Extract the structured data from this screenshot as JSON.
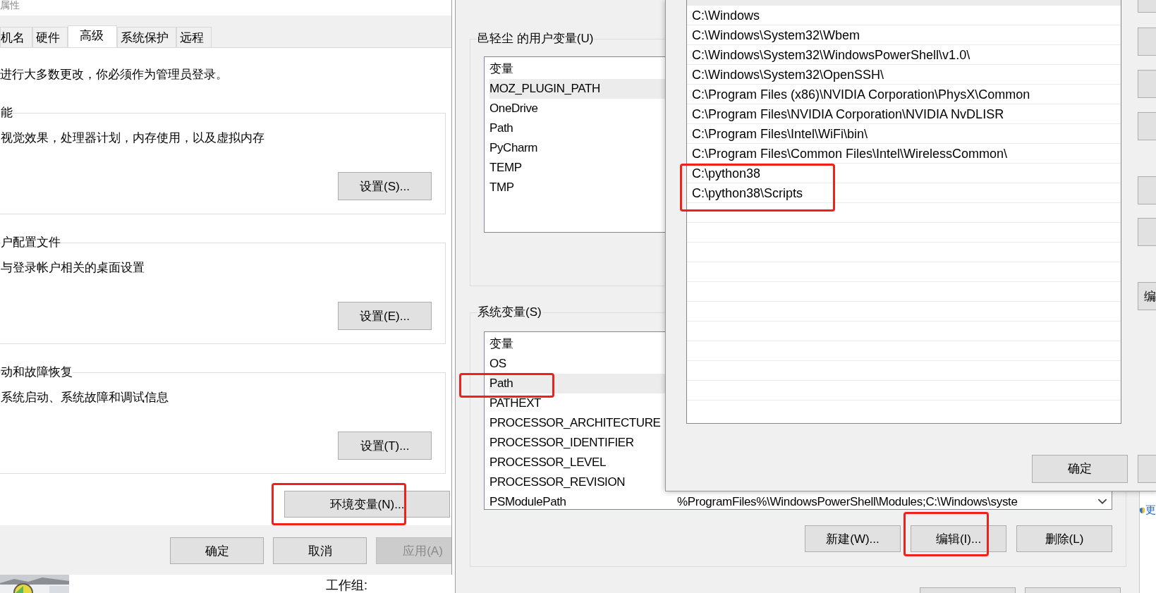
{
  "system_properties": {
    "title": "属性",
    "tabs": [
      {
        "label": "机名",
        "selected": false
      },
      {
        "label": "硬件",
        "selected": false
      },
      {
        "label": "高级",
        "selected": true
      },
      {
        "label": "系统保护",
        "selected": false
      },
      {
        "label": "远程",
        "selected": false
      }
    ],
    "notice": "进行大多数更改，你必须作为管理员登录。",
    "groups": [
      {
        "title": "能",
        "description": "视觉效果，处理器计划，内存使用，以及虚拟内存",
        "button": "设置(S)..."
      },
      {
        "title": "户配置文件",
        "description": "与登录帐户相关的桌面设置",
        "button": "设置(E)..."
      },
      {
        "title": "动和故障恢复",
        "description": "系统启动、系统故障和调试信息",
        "button": "设置(T)..."
      }
    ],
    "env_button": {
      "label": "环境变量(N)...",
      "highlighted": true
    },
    "buttons": [
      {
        "label": "确定",
        "disabled": false
      },
      {
        "label": "取消",
        "disabled": false
      },
      {
        "label": "应用(A)",
        "disabled": true
      }
    ]
  },
  "background": {
    "label": "工作组:",
    "link": "更"
  },
  "environment_variables": {
    "user_group": "邑轻尘 的用户变量(U)",
    "user_header": "变量",
    "user_vars": [
      {
        "name": "MOZ_PLUGIN_PATH",
        "selected": true,
        "highlighted": false
      },
      {
        "name": "OneDrive",
        "selected": false,
        "highlighted": false
      },
      {
        "name": "Path",
        "selected": false,
        "highlighted": false
      },
      {
        "name": "PyCharm",
        "selected": false,
        "highlighted": false
      },
      {
        "name": "TEMP",
        "selected": false,
        "highlighted": false
      },
      {
        "name": "TMP",
        "selected": false,
        "highlighted": false
      }
    ],
    "system_group": "系统变量(S)",
    "system_header": "变量",
    "system_vars": [
      {
        "name": "OS",
        "selected": false,
        "highlighted": false
      },
      {
        "name": "Path",
        "selected": true,
        "highlighted": true
      },
      {
        "name": "PATHEXT",
        "selected": false,
        "highlighted": false
      },
      {
        "name": "PROCESSOR_ARCHITECTURE",
        "selected": false,
        "highlighted": false
      },
      {
        "name": "PROCESSOR_IDENTIFIER",
        "selected": false,
        "highlighted": false
      },
      {
        "name": "PROCESSOR_LEVEL",
        "selected": false,
        "highlighted": false
      },
      {
        "name": "PROCESSOR_REVISION",
        "selected": false,
        "highlighted": false
      },
      {
        "name": "PSModulePath",
        "value": "%ProgramFiles%\\WindowsPowerShell\\Modules;C:\\Windows\\syste",
        "selected": false,
        "highlighted": false
      }
    ],
    "buttons": [
      {
        "label": "新建(W)...",
        "highlighted": false
      },
      {
        "label": "编辑(I)...",
        "highlighted": true
      },
      {
        "label": "删除(L)",
        "highlighted": false
      }
    ]
  },
  "edit_path_dialog": {
    "paths": [
      {
        "text": "C:\\Windows",
        "highlighted": false
      },
      {
        "text": "C:\\Windows\\System32\\Wbem",
        "highlighted": false
      },
      {
        "text": "C:\\Windows\\System32\\WindowsPowerShell\\v1.0\\",
        "highlighted": false
      },
      {
        "text": "C:\\Windows\\System32\\OpenSSH\\",
        "highlighted": false
      },
      {
        "text": "C:\\Program Files (x86)\\NVIDIA Corporation\\PhysX\\Common",
        "highlighted": false
      },
      {
        "text": "C:\\Program Files\\NVIDIA Corporation\\NVIDIA NvDLISR",
        "highlighted": false
      },
      {
        "text": "C:\\Program Files\\Intel\\WiFi\\bin\\",
        "highlighted": false
      },
      {
        "text": "C:\\Program Files\\Common Files\\Intel\\WirelessCommon\\",
        "highlighted": false
      },
      {
        "text": "C:\\python38",
        "highlighted": true
      },
      {
        "text": "C:\\python38\\Scripts",
        "highlighted": true
      }
    ],
    "side_button_label": "编",
    "ok_button": "确定"
  }
}
